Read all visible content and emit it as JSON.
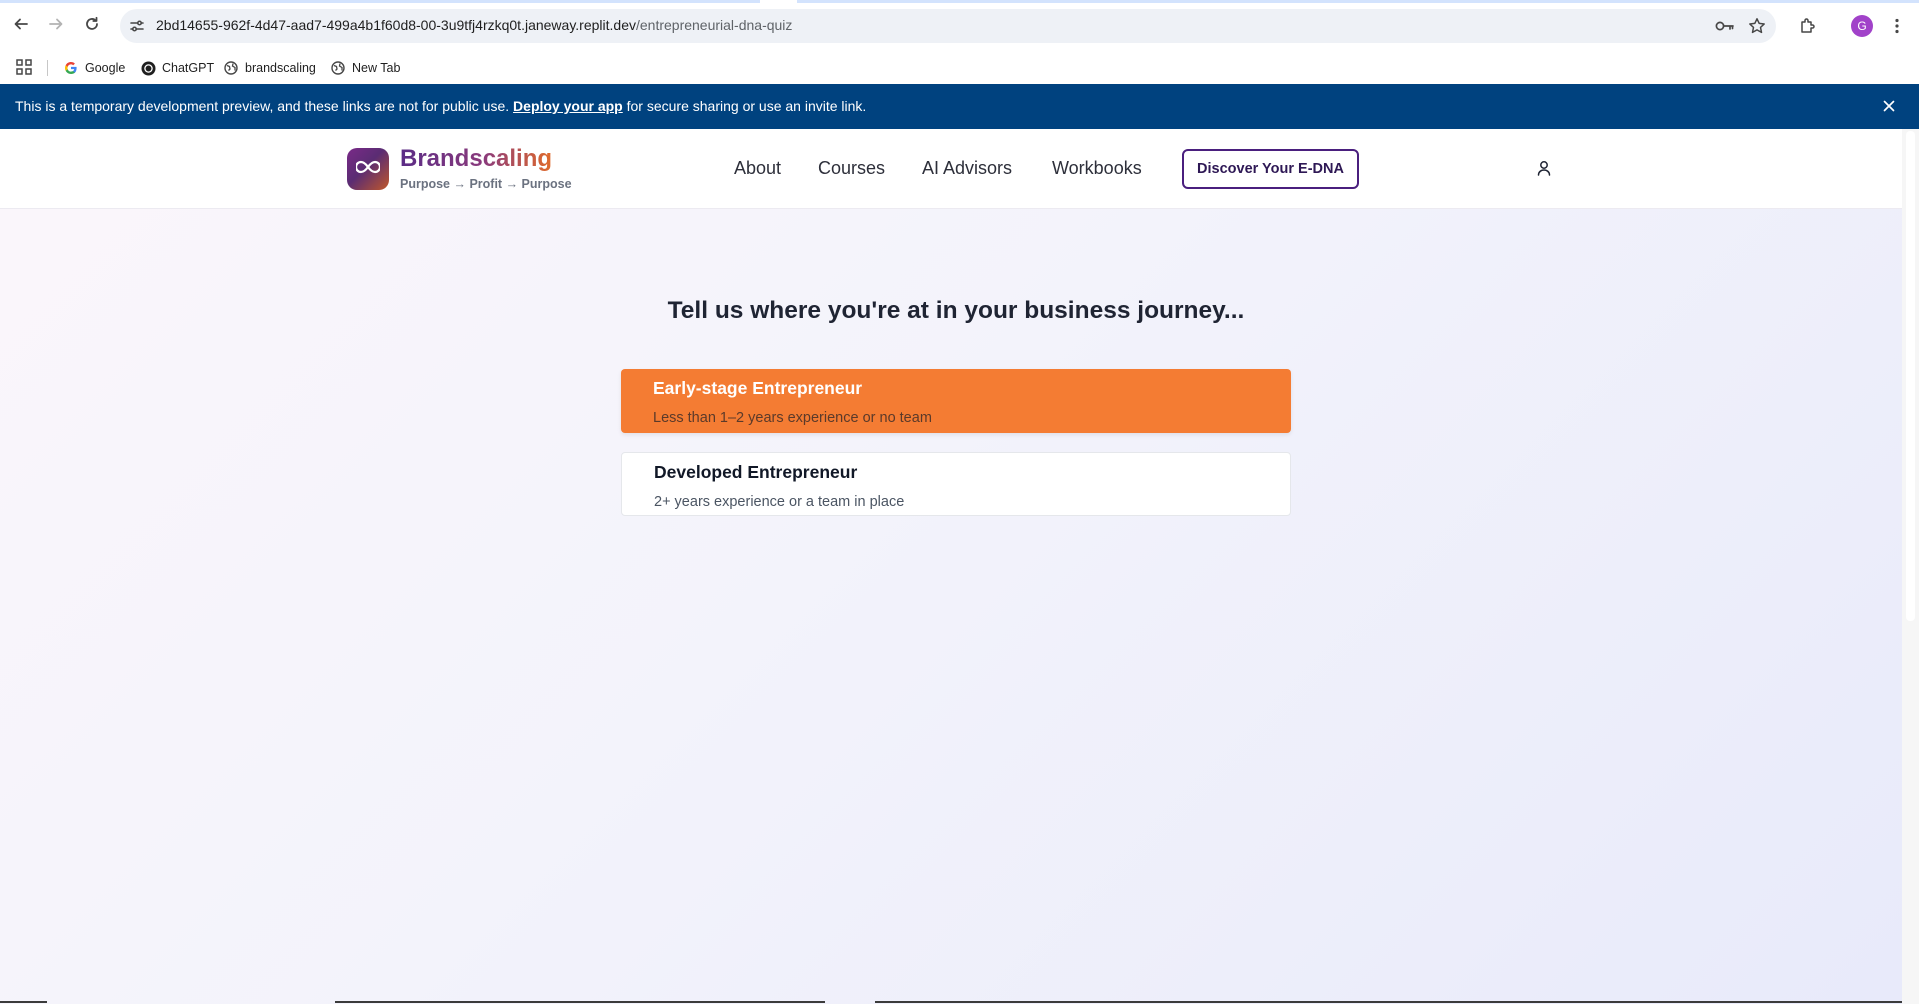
{
  "browser": {
    "url_host": "2bd14655-962f-4d47-aad7-499a4b1f60d8-00-3u9tfj4rzkq0t.janeway.replit.dev",
    "url_path": "/entrepreneurial-dna-quiz",
    "profile_initial": "G",
    "bookmarks": [
      {
        "label": "Google",
        "icon": "google-icon"
      },
      {
        "label": "ChatGPT",
        "icon": "chatgpt-icon"
      },
      {
        "label": "brandscaling",
        "icon": "globe-icon"
      },
      {
        "label": "New Tab",
        "icon": "globe-icon"
      }
    ]
  },
  "banner": {
    "text_before": "This is a temporary development preview, and these links are not for public use. ",
    "link": "Deploy your app",
    "text_after": " for secure sharing or use an invite link."
  },
  "header": {
    "brand_name": "Brandscaling",
    "brand_tagline": "Purpose → Profit → Purpose",
    "nav": [
      "About",
      "Courses",
      "AI Advisors",
      "Workbooks"
    ],
    "cta": "Discover Your E-DNA"
  },
  "quiz": {
    "headline": "Tell us where you're at in your business journey...",
    "options": [
      {
        "title": "Early-stage Entrepreneur",
        "subtitle": "Less than 1–2 years experience or no team",
        "selected": true
      },
      {
        "title": "Developed Entrepreneur",
        "subtitle": "2+ years experience or a team in place",
        "selected": false
      }
    ]
  },
  "colors": {
    "banner_bg": "#00427f",
    "selected_option": "#f47c33",
    "cta_border": "#4a1f7e"
  }
}
